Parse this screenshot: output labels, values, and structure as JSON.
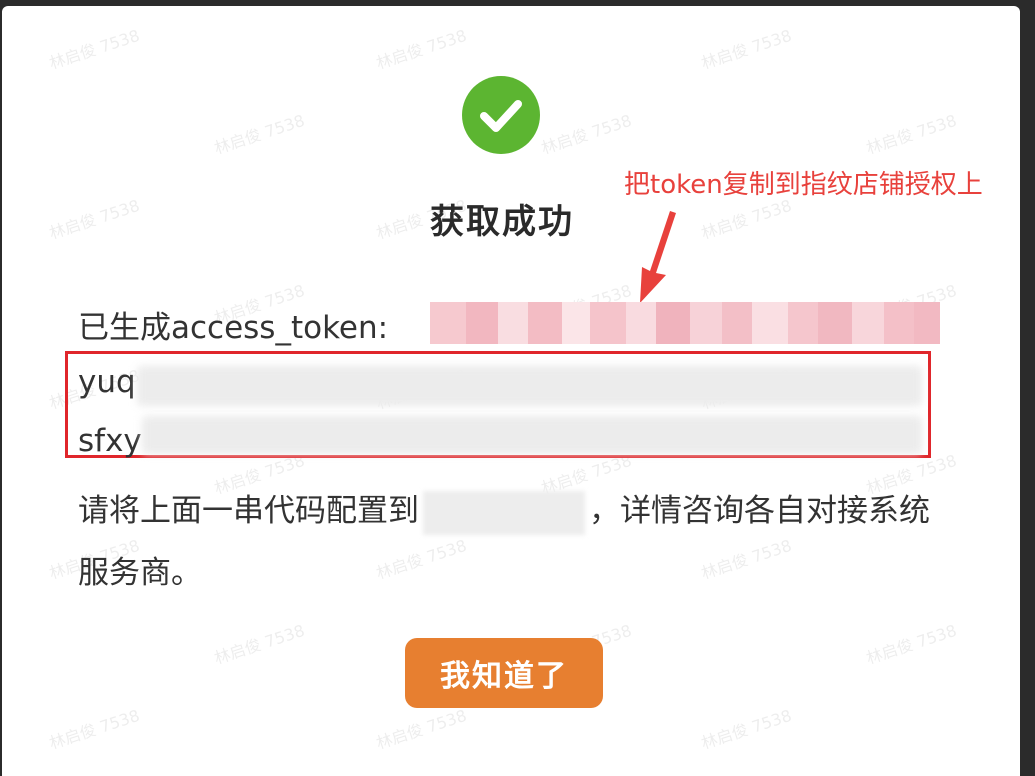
{
  "dialog": {
    "title": "获取成功",
    "token_label": "已生成access_token:",
    "token_visible_start": "\u0000",
    "code_lines": [
      {
        "prefix": "yuq"
      },
      {
        "prefix": "sfxy"
      }
    ],
    "description_part1": "请将上面一串代码配置到",
    "description_part2": "，详情咨询各自对接系统服务商。",
    "button_label": "我知道了"
  },
  "annotation": {
    "text": "把token复制到指纹店铺授权上",
    "color": "#e8413c"
  },
  "watermark": {
    "text": "林启俊 7538"
  },
  "colors": {
    "success_green": "#5cb531",
    "button_orange": "#e77f30",
    "highlight_red": "#e0262b"
  }
}
